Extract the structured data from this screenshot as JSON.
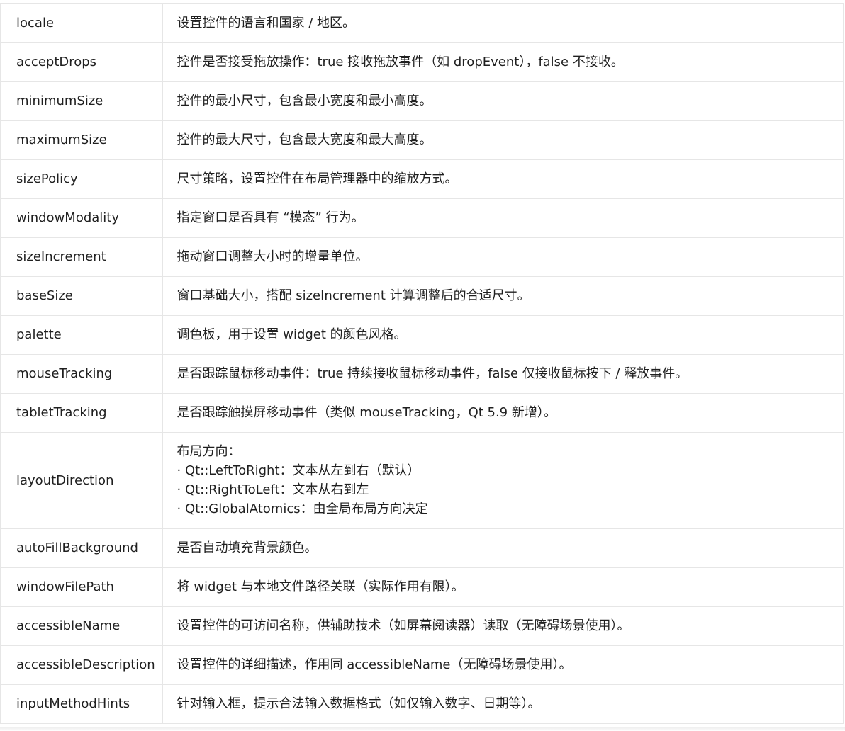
{
  "rows": [
    {
      "property": "locale",
      "description": "设置控件的语言和国家 / 地区。"
    },
    {
      "property": "acceptDrops",
      "description": "控件是否接受拖放操作：true 接收拖放事件（如 dropEvent），false 不接收。"
    },
    {
      "property": "minimumSize",
      "description": "控件的最小尺寸，包含最小宽度和最小高度。"
    },
    {
      "property": "maximumSize",
      "description": "控件的最大尺寸，包含最大宽度和最大高度。"
    },
    {
      "property": "sizePolicy",
      "description": "尺寸策略，设置控件在布局管理器中的缩放方式。"
    },
    {
      "property": "windowModality",
      "description": "指定窗口是否具有 “模态” 行为。"
    },
    {
      "property": "sizeIncrement",
      "description": "拖动窗口调整大小时的增量单位。"
    },
    {
      "property": "baseSize",
      "description": "窗口基础大小，搭配 sizeIncrement 计算调整后的合适尺寸。"
    },
    {
      "property": "palette",
      "description": "调色板，用于设置 widget 的颜色风格。"
    },
    {
      "property": "mouseTracking",
      "description": "是否跟踪鼠标移动事件：true 持续接收鼠标移动事件，false 仅接收鼠标按下 / 释放事件。"
    },
    {
      "property": "tabletTracking",
      "description": "是否跟踪触摸屏移动事件（类似 mouseTracking，Qt 5.9 新增）。"
    },
    {
      "property": "layoutDirection",
      "description_lines": [
        "布局方向：",
        "· Qt::LeftToRight：文本从左到右（默认）",
        "· Qt::RightToLeft：文本从右到左",
        "· Qt::GlobalAtomics：由全局布局方向决定"
      ]
    },
    {
      "property": "autoFillBackground",
      "description": "是否自动填充背景颜色。"
    },
    {
      "property": "windowFilePath",
      "description": "将 widget 与本地文件路径关联（实际作用有限）。"
    },
    {
      "property": "accessibleName",
      "description": "设置控件的可访问名称，供辅助技术（如屏幕阅读器）读取（无障碍场景使用）。"
    },
    {
      "property": "accessibleDescription",
      "description": "设置控件的详细描述，作用同 accessibleName（无障碍场景使用）。"
    },
    {
      "property": "inputMethodHints",
      "description": "针对输入框，提示合法输入数据格式（如仅输入数字、日期等）。"
    }
  ]
}
